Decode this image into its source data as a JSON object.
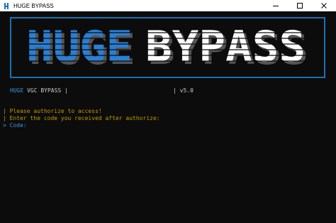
{
  "window": {
    "title": "HUGE BYPASS",
    "icon": "app-icon",
    "controls": [
      "minimize-icon",
      "maximize-icon",
      "close-icon"
    ]
  },
  "banner": {
    "word1": "HUGE",
    "word2": "BYPASS",
    "word1_color": "#2a7fd4",
    "word2_color": "#ffffff",
    "border_color": "#1f6fb0"
  },
  "header": {
    "brand": "HUGE",
    "name": "VGC BYPASS",
    "sep1": "|",
    "sep2": "|",
    "version": "v5.0"
  },
  "console": {
    "lines": [
      {
        "prefix": "|",
        "text": "Please authorize to access!"
      },
      {
        "prefix": "|",
        "text": "Enter the code you received after authorize:"
      }
    ],
    "prompt": {
      "prefix": ">",
      "label": "Code:"
    }
  },
  "colors": {
    "background": "#0c0c0c",
    "blue": "#3a96dd",
    "yellow": "#c19c00",
    "white": "#cccccc"
  }
}
